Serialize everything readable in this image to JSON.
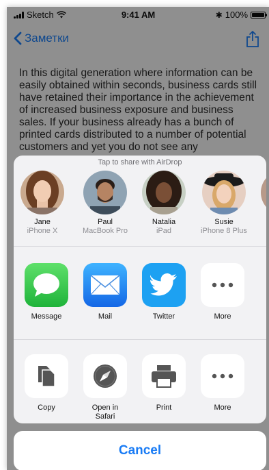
{
  "status_bar": {
    "carrier": "Sketch",
    "time": "9:41 AM",
    "battery_percent": "100%",
    "battery_level": 1.0
  },
  "nav": {
    "back_label": "Заметки",
    "share_icon": "share-icon"
  },
  "note": {
    "text": "In this digital generation where information can be easily obtained within seconds, business cards still have retained their importance in the achievement of increased business exposure and business sales. If your business already has a bunch of printed cards distributed to a number of potential customers and yet you do not see any"
  },
  "airdrop": {
    "caption": "Tap to share with AirDrop",
    "people": [
      {
        "name": "Jane",
        "device": "iPhone X"
      },
      {
        "name": "Paul",
        "device": "MacBook Pro"
      },
      {
        "name": "Natalia",
        "device": "iPad"
      },
      {
        "name": "Susie",
        "device": "iPhone 8 Plus"
      }
    ]
  },
  "share_apps": [
    {
      "label": "Message",
      "icon": "message-icon",
      "color": "#34c759"
    },
    {
      "label": "Mail",
      "icon": "mail-icon",
      "color": "#1a7cf5"
    },
    {
      "label": "Twitter",
      "icon": "twitter-icon",
      "color": "#1da1f2"
    },
    {
      "label": "More",
      "icon": "more-icon",
      "color": "#ffffff"
    }
  ],
  "actions": [
    {
      "label": "Copy",
      "icon": "copy-icon"
    },
    {
      "label": "Open in Safari",
      "icon": "safari-icon"
    },
    {
      "label": "Print",
      "icon": "print-icon"
    },
    {
      "label": "More",
      "icon": "more-icon"
    }
  ],
  "cancel_label": "Cancel",
  "colors": {
    "accent": "#1a7cf5",
    "overlay": "rgba(0,0,0,0.42)",
    "sheet_bg": "#f2f2f4"
  }
}
